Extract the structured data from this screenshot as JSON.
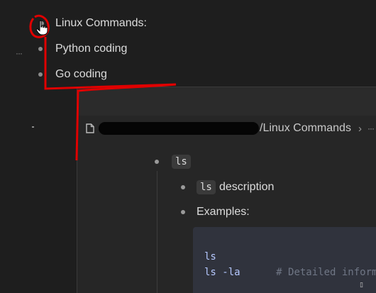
{
  "outline": {
    "items": [
      {
        "label": "Linux Commands:"
      },
      {
        "label": "Python coding"
      },
      {
        "label": "Go coding"
      }
    ],
    "handle_glyph": "···"
  },
  "popup": {
    "breadcrumb": {
      "icon": "document-icon",
      "path_visible": "/Linux Commands",
      "separator": "›",
      "more": "···"
    },
    "block": {
      "root_chip": "ls",
      "children": [
        {
          "chip": "ls",
          "text": "description"
        },
        {
          "text": "Examples:"
        }
      ],
      "code": {
        "line1": "ls",
        "line2_cmd": "ls -la",
        "line2_comment": "# Detailed informa"
      }
    }
  },
  "colors": {
    "annotation": "#e00000",
    "background": "#1e1e1e",
    "code_block": "#30333d"
  },
  "mouse_indicator": "▯"
}
